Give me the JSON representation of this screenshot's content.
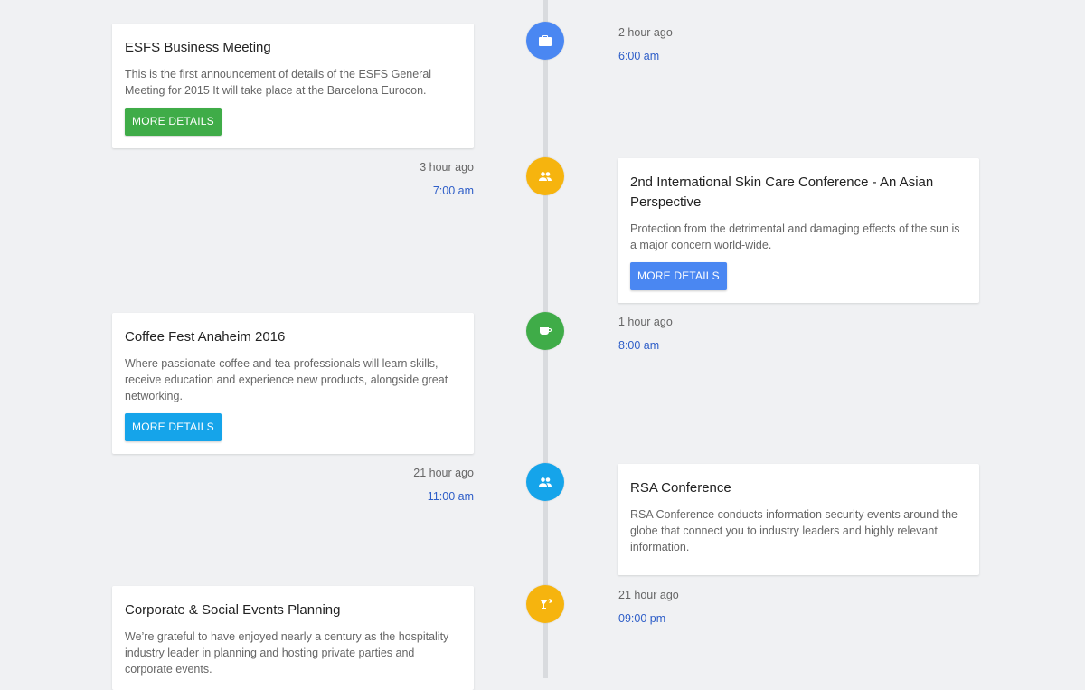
{
  "colors": {
    "blue": "#4a87f2",
    "amber": "#f6b40e",
    "green": "#3fac48",
    "light_blue": "#15a4ea",
    "time_text": "#2e5ec8"
  },
  "events": [
    {
      "title": "ESFS Business Meeting",
      "description": "This is the first announcement of details of the ESFS General Meeting for 2015 It will take place at the Barcelona Eurocon.",
      "button_label": "MORE DETAILS",
      "ago": "2 hour ago",
      "time": "6:00 am",
      "icon": "briefcase-icon",
      "icon_color": "#4a87f2",
      "button_color": "#3fac48"
    },
    {
      "title": "2nd International Skin Care Conference - An Asian Perspective",
      "description": "Protection from the detrimental and damaging effects of the sun is a major concern world-wide.",
      "button_label": "MORE DETAILS",
      "ago": "3 hour ago",
      "time": "7:00 am",
      "icon": "people-icon",
      "icon_color": "#f6b40e",
      "button_color": "#4a87f2"
    },
    {
      "title": "Coffee Fest Anaheim 2016",
      "description": "Where passionate coffee and tea professionals will learn skills, receive education and experience new products, alongside great networking.",
      "button_label": "MORE DETAILS",
      "ago": "1 hour ago",
      "time": "8:00 am",
      "icon": "coffee-cup-icon",
      "icon_color": "#3fac48",
      "button_color": "#15a4ea"
    },
    {
      "title": "RSA Conference",
      "description": "RSA Conference conducts information security events around the globe that connect you to industry leaders and highly relevant information.",
      "ago": "21 hour ago",
      "time": "11:00 am",
      "icon": "people-icon",
      "icon_color": "#15a4ea"
    },
    {
      "title": "Corporate & Social Events Planning",
      "description": "We’re grateful to have enjoyed nearly a century as the hospitality industry leader in planning and hosting private parties and corporate events.",
      "ago": "21 hour ago",
      "time": "09:00 pm",
      "icon": "cocktail-icon",
      "icon_color": "#f6b40e"
    }
  ]
}
